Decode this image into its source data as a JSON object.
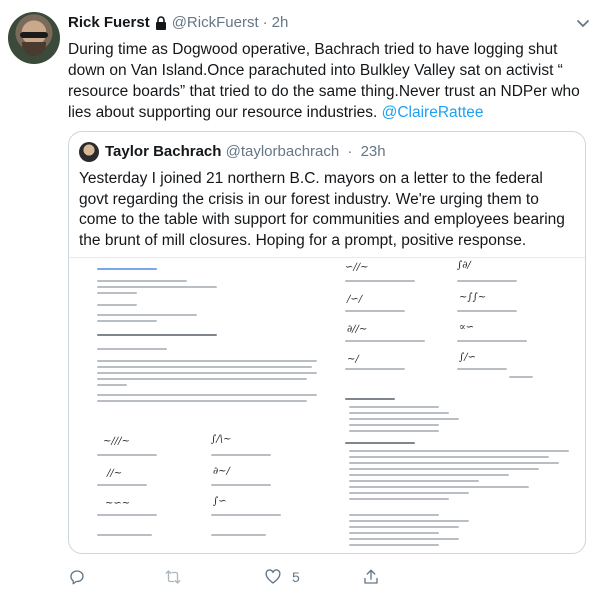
{
  "tweet": {
    "author_name": "Rick Fuerst",
    "author_handle": "@RickFuerst",
    "separator": "·",
    "time": "2h",
    "text": "During time as Dogwood operative, Bachrach tried to have logging shut down on Van Island.Once parachuted into Bulkley Valley sat on activist “ resource boards” that tried to do the same thing.Never trust an NDPer who lies about supporting our resource industries. ",
    "mention": "@ClaireRattee"
  },
  "quoted_tweet": {
    "author_name": "Taylor Bachrach",
    "author_handle": "@taylorbachrach",
    "separator": "·",
    "time": "23h",
    "text": "Yesterday I joined 21 northern B.C. mayors on a letter to the federal govt regarding the crisis in our forest industry. We're urging them to come to the table with support for communities and employees bearing the brunt of mill closures. Hoping for a prompt, positive response."
  },
  "actions": {
    "reply_count": "",
    "retweet_count": "",
    "like_count": "5"
  },
  "colors": {
    "link": "#1da1f2",
    "muted": "#657786",
    "border": "#ccd6dd"
  },
  "icons": [
    "lock-icon",
    "chevron-down-icon",
    "reply-icon",
    "retweet-icon",
    "like-icon",
    "share-icon"
  ]
}
